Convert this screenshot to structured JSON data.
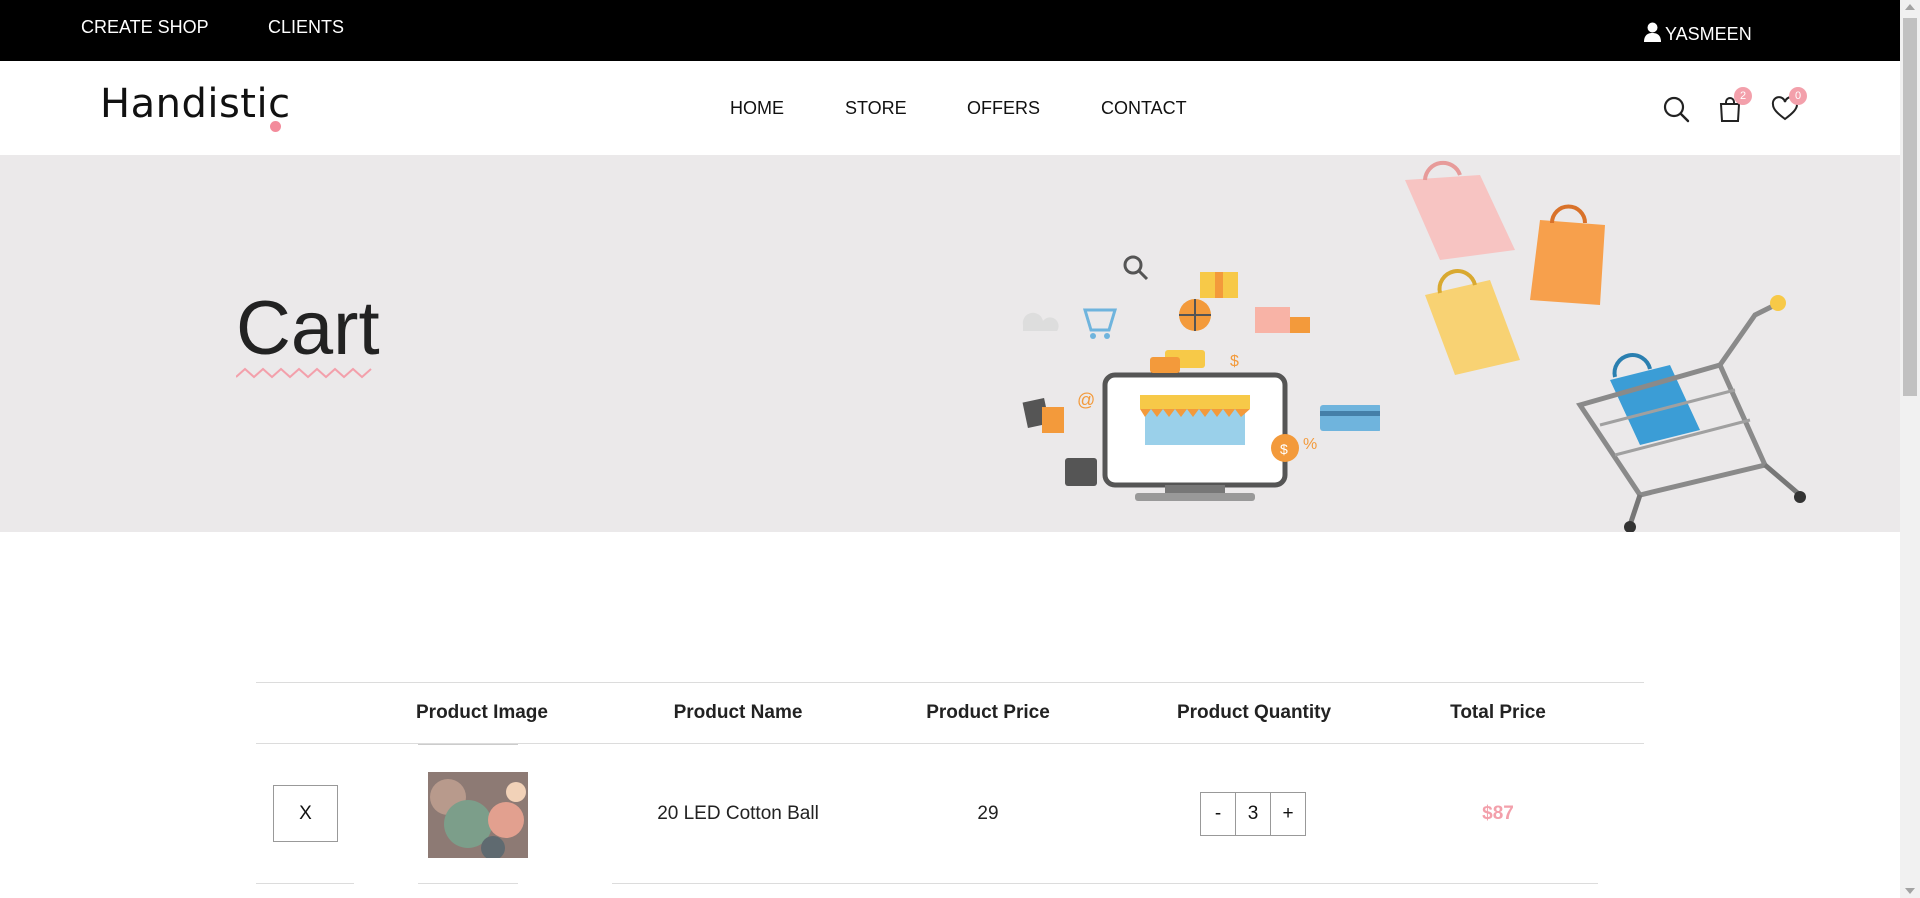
{
  "topbar": {
    "create_shop": "CREATE SHOP",
    "clients": "CLIENTS",
    "user": "YASMEEN"
  },
  "header": {
    "logo": "Handistic",
    "nav": [
      "HOME",
      "STORE",
      "OFFERS",
      "CONTACT"
    ],
    "cart_count": "2",
    "wishlist_count": "0"
  },
  "hero": {
    "title": "Cart"
  },
  "table": {
    "headers": [
      "Product Image",
      "Product Name",
      "Product Price",
      "Product Quantity",
      "Total Price"
    ],
    "rows": [
      {
        "remove_label": "X",
        "name": "20 LED Cotton Ball",
        "price": "29",
        "quantity": "3",
        "total": "$87"
      }
    ],
    "minus_label": "-",
    "plus_label": "+"
  },
  "colors": {
    "accent": "#f3a0ab",
    "topbar": "#000000",
    "hero_bg": "#ebe9ea"
  }
}
